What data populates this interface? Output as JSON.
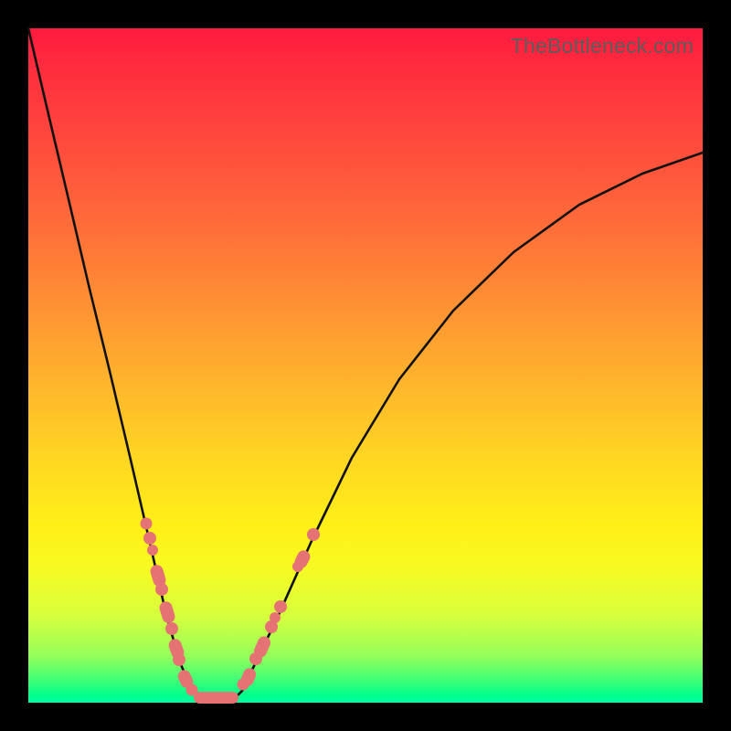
{
  "watermark": {
    "text": "TheBottleneck.com"
  },
  "colors": {
    "pill": "#e57373",
    "curve": "#111111",
    "frame": "#000000",
    "gradient_top": "#ff1a3f",
    "gradient_bottom": "#00ffa5"
  },
  "chart_data": {
    "type": "line",
    "title": "",
    "xlabel": "",
    "ylabel": "",
    "xlim": [
      0,
      1
    ],
    "ylim": [
      0,
      1
    ],
    "note": "Axes not shown; values render in a 738x738 plot area with y=0 at bottom. Data below is normalized (y = distance from bottom / 738).",
    "series": [
      {
        "name": "curve-left",
        "x": [
          0.0,
          0.03,
          0.06,
          0.09,
          0.12,
          0.15,
          0.18,
          0.205,
          0.225,
          0.245,
          0.262
        ],
        "values": [
          1.0,
          0.873,
          0.746,
          0.62,
          0.492,
          0.365,
          0.237,
          0.13,
          0.06,
          0.018,
          0.004
        ]
      },
      {
        "name": "curve-bottom",
        "x": [
          0.262,
          0.28,
          0.3
        ],
        "values": [
          0.004,
          0.003,
          0.004
        ]
      },
      {
        "name": "curve-right",
        "x": [
          0.3,
          0.33,
          0.37,
          0.42,
          0.48,
          0.55,
          0.63,
          0.72,
          0.82,
          0.91,
          1.0
        ],
        "values": [
          0.004,
          0.046,
          0.128,
          0.24,
          0.363,
          0.48,
          0.582,
          0.668,
          0.738,
          0.784,
          0.816
        ]
      }
    ],
    "marker_track_left": {
      "name": "pink-markers-left",
      "description": "Pink dots/pills along left branch of curve in lower region.",
      "points": [
        {
          "x": 0.175,
          "y": 0.266
        },
        {
          "x": 0.18,
          "y": 0.244
        },
        {
          "x": 0.184,
          "y": 0.226
        },
        {
          "x": 0.192,
          "y": 0.193
        },
        {
          "x": 0.198,
          "y": 0.168
        },
        {
          "x": 0.206,
          "y": 0.134
        },
        {
          "x": 0.212,
          "y": 0.11
        },
        {
          "x": 0.219,
          "y": 0.083
        },
        {
          "x": 0.224,
          "y": 0.064
        },
        {
          "x": 0.233,
          "y": 0.038
        },
        {
          "x": 0.242,
          "y": 0.019
        }
      ]
    },
    "marker_track_right": {
      "name": "pink-markers-right",
      "description": "Pink dots/pills along right branch of curve in lower region.",
      "points": [
        {
          "x": 0.318,
          "y": 0.027
        },
        {
          "x": 0.326,
          "y": 0.041
        },
        {
          "x": 0.338,
          "y": 0.065
        },
        {
          "x": 0.349,
          "y": 0.09
        },
        {
          "x": 0.36,
          "y": 0.113
        },
        {
          "x": 0.366,
          "y": 0.126
        },
        {
          "x": 0.374,
          "y": 0.143
        },
        {
          "x": 0.4,
          "y": 0.202
        },
        {
          "x": 0.406,
          "y": 0.215
        },
        {
          "x": 0.422,
          "y": 0.25
        }
      ]
    },
    "bottom_pill": {
      "name": "pink-bottom-pill",
      "x_start": 0.245,
      "x_end": 0.311,
      "y": 0.003
    }
  }
}
